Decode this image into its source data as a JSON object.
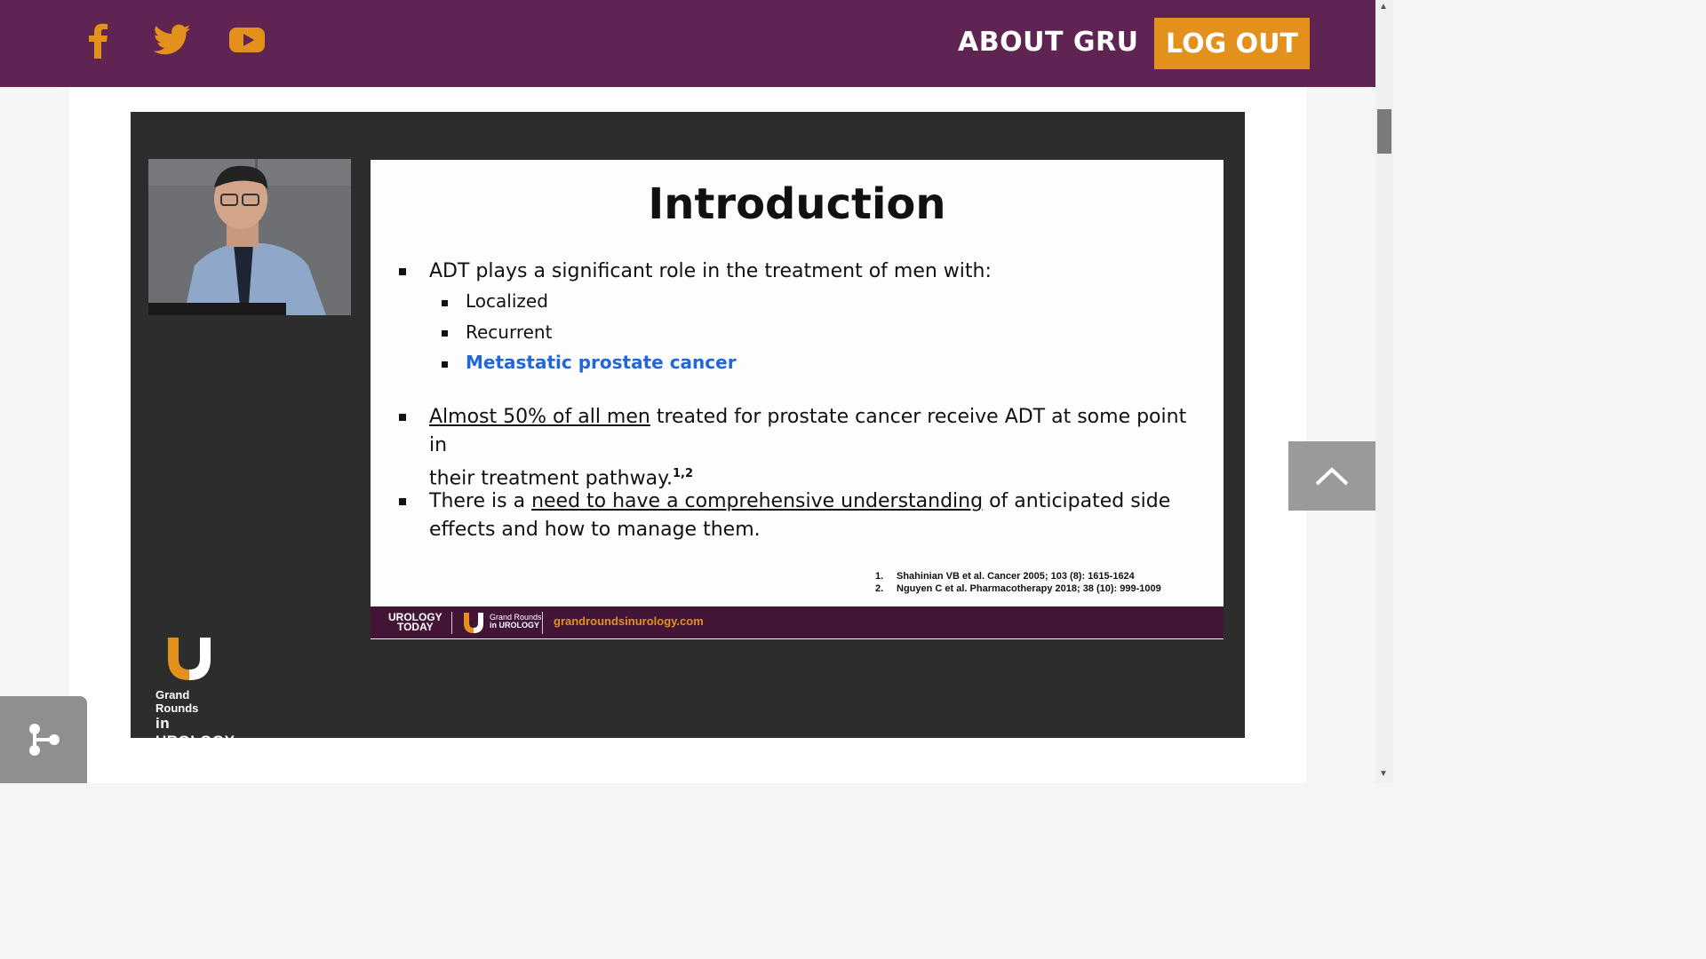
{
  "header": {
    "social": [
      {
        "name": "facebook-icon"
      },
      {
        "name": "twitter-icon"
      },
      {
        "name": "youtube-icon"
      }
    ],
    "nav_about": "ABOUT GRU",
    "logout": "LOG OUT",
    "colors": {
      "bar": "#5f2451",
      "accent": "#e3911c"
    }
  },
  "slide": {
    "title": "Introduction",
    "bullet1": "ADT plays a significant role in the treatment of men with:",
    "sub_items": [
      "Localized",
      "Recurrent",
      "Metastatic prostate cancer"
    ],
    "bullet2_underlined": "Almost 50% of all men",
    "bullet2_rest_line1": " treated for prostate cancer receive ADT at some point in",
    "bullet2_line2": "their treatment pathway.",
    "bullet2_sup": "1,2",
    "bullet3_pre": "There is a ",
    "bullet3_underlined": "need to have a comprehensive understanding",
    "bullet3_post": " of anticipated side",
    "bullet3_line2": "effects and how to manage them.",
    "refs": [
      {
        "n": "1.",
        "text": "Shahinian VB et al. Cancer 2005; 103 (8): 1615-1624"
      },
      {
        "n": "2.",
        "text": "Nguyen C et al. Pharmacotherapy 2018; 38 (10): 999-1009"
      }
    ],
    "footer": {
      "brand1_line1": "UROLOGY",
      "brand1_line2": "TODAY",
      "brand2_line1": "Grand Rounds",
      "brand2_line2": "in UROLOGY",
      "site": "grandroundsinurology.com"
    }
  },
  "corner_logo": {
    "line1": "Grand Rounds",
    "line2": "in UROLOGY."
  },
  "controls": {
    "scroll_top_icon": "chevron-up-icon",
    "widget_icon": "share-nodes-icon"
  }
}
